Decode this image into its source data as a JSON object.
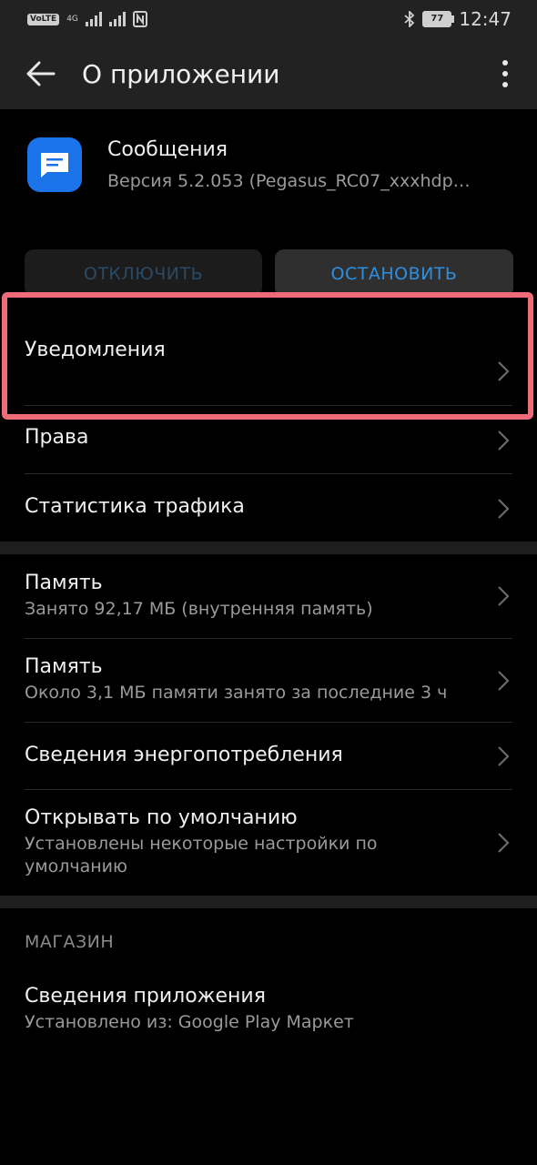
{
  "status_bar": {
    "left_badge": "VoLTE",
    "network": "4G",
    "time": "12:47",
    "battery": "77"
  },
  "app_bar": {
    "title": "О приложении"
  },
  "app": {
    "name": "Сообщения",
    "version": "Версия 5.2.053 (Pegasus_RC07_xxxhdpi..."
  },
  "buttons": {
    "disable": "ОТКЛЮЧИТЬ",
    "stop": "ОСТАНОВИТЬ"
  },
  "list_1": [
    {
      "title": "Уведомления"
    },
    {
      "title": "Права"
    },
    {
      "title": "Статистика трафика"
    }
  ],
  "list_2": [
    {
      "title": "Память",
      "subtitle": "Занято 92,17 МБ (внутренняя память)"
    },
    {
      "title": "Память",
      "subtitle": "Около 3,1 МБ памяти занято за последние 3 ч"
    },
    {
      "title": "Сведения энергопотребления"
    },
    {
      "title": "Открывать по умолчанию",
      "subtitle": "Установлены некоторые настройки по умолчанию"
    }
  ],
  "store": {
    "label": "МАГАЗИН",
    "item": {
      "title": "Сведения приложения",
      "subtitle": "Установлено из: Google Play Маркет"
    }
  },
  "colors": {
    "accent": "#2e8fe0",
    "highlight": "#ef6b78",
    "app_icon": "#1a73e8"
  }
}
